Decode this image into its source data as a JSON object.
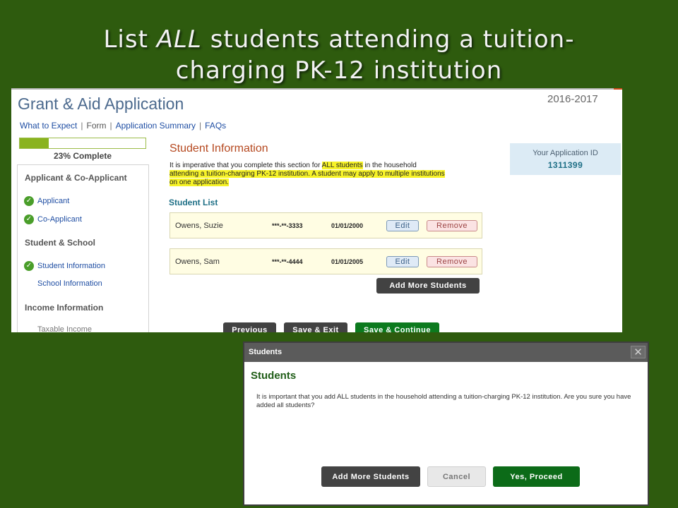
{
  "slide": {
    "title_line1_a": "List ",
    "title_line1_em": "ALL",
    "title_line1_b": " students attending a tuition-",
    "title_line2": "charging PK-12 institution"
  },
  "app": {
    "title": "Grant & Aid Application",
    "year": "2016-2017",
    "nav": [
      "What to Expect",
      "Form",
      "Application Summary",
      "FAQs"
    ],
    "progress": {
      "percent": 23,
      "label": "23% Complete"
    },
    "sidebar": {
      "sections": [
        {
          "heading": "Applicant & Co-Applicant",
          "items": [
            "Applicant",
            "Co-Applicant"
          ]
        },
        {
          "heading": "Student & School",
          "items": [
            "Student Information",
            "School Information"
          ]
        },
        {
          "heading": "Income Information",
          "items": [
            "Taxable Income"
          ]
        }
      ]
    },
    "section": {
      "title": "Student Information",
      "text_a": "It is imperative that you complete this section for ",
      "text_hl1": "ALL students",
      "text_b": " in the household ",
      "text_hl2": "attending a tuition-charging PK-12 institution. A student may apply to multiple institutions on one application."
    },
    "application_id": {
      "label": "Your Application ID",
      "value": "1311399"
    },
    "student_list": {
      "title": "Student List",
      "rows": [
        {
          "name": "Owens, Suzie",
          "ssn": "***-**-3333",
          "dob": "01/01/2000",
          "edit": "Edit",
          "remove": "Remove"
        },
        {
          "name": "Owens, Sam",
          "ssn": "***-**-4444",
          "dob": "01/01/2005",
          "edit": "Edit",
          "remove": "Remove"
        }
      ],
      "add_more": "Add More Students"
    },
    "footer_buttons": {
      "previous": "Previous",
      "save_exit": "Save & Exit",
      "save_continue": "Save & Continue"
    }
  },
  "modal": {
    "bar_title": "Students",
    "close_glyph": "✕",
    "heading": "Students",
    "text": "It is important that you add ALL students in the household attending a tuition-charging PK-12 institution. Are you sure you have added all students?",
    "buttons": {
      "add_more": "Add More Students",
      "cancel": "Cancel",
      "proceed": "Yes, Proceed"
    }
  },
  "icons": {
    "check": "checkmark-icon",
    "close": "close-icon"
  },
  "colors": {
    "background": "#2e5b0e",
    "accent_green": "#0c7a1e",
    "section_title": "#b5481f",
    "highlight": "#f7f327"
  }
}
